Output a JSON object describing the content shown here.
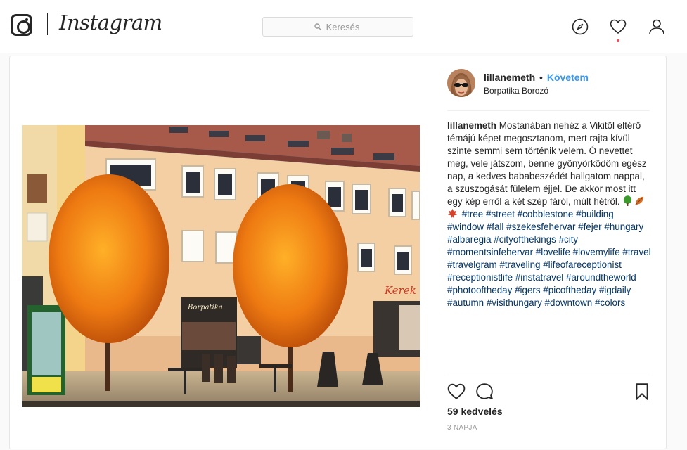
{
  "nav": {
    "brand": "Instagram",
    "search_placeholder": "Keresés",
    "icons": [
      "explore-icon",
      "heart-icon",
      "profile-icon"
    ],
    "activity_dot_color": "#ed4956"
  },
  "post": {
    "username": "lillanemeth",
    "separator": "•",
    "follow_label": "Követem",
    "location": "Borpatika Borozó",
    "caption": {
      "user": "lillanemeth",
      "text": "Mostanában nehéz a Vikitől eltérő témájú képet megosztanom, mert rajta kívül szinte semmi sem történik velem. Ó nevettet meg, vele játszom, benne gyönyörködöm egész nap, a kedves bababeszédét hallgatom nappal, a szuszogását fülelem éjjel. De akkor most itt egy kép erről a két szép fáról, múlt hétről.",
      "emojis": [
        "tree-emoji",
        "fallen-leaf-emoji",
        "maple-leaf-emoji"
      ],
      "hashtags": [
        "#tree",
        "#street",
        "#cobblestone",
        "#building",
        "#window",
        "#fall",
        "#szekesfehervar",
        "#fejer",
        "#hungary",
        "#albaregia",
        "#cityofthekings",
        "#city",
        "#momentsinfehervar",
        "#lovelife",
        "#lovemylife",
        "#travel",
        "#travelgram",
        "#traveling",
        "#lifeofareceptionist",
        "#receptionistlife",
        "#instatravel",
        "#aroundtheworld",
        "#photooftheday",
        "#igers",
        "#picoftheday",
        "#igdaily",
        "#autumn",
        "#visithungary",
        "#downtown",
        "#colors"
      ]
    },
    "likes": "59 kedvelés",
    "timestamp": "3 NAPJA",
    "colors": {
      "link": "#3897f0",
      "hashtag": "#003569",
      "muted": "#999999"
    }
  }
}
